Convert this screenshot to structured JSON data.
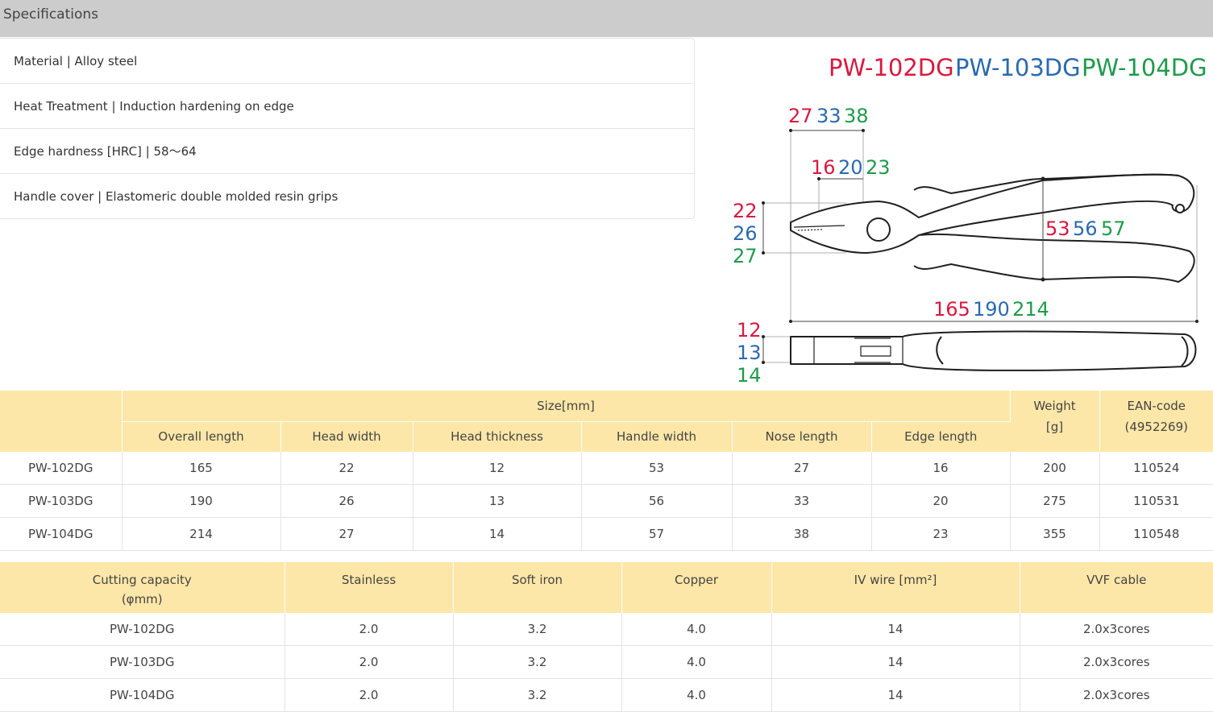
{
  "section_title": "Specifications",
  "specs": [
    "Material | Alloy steel",
    "Heat Treatment | Induction hardening on edge",
    "Edge hardness [HRC] | 58～64",
    "Handle cover | Elastomeric double molded resin grips"
  ],
  "colors": {
    "red": "#d8193f",
    "blue": "#2a6aae",
    "green": "#1f9a4b",
    "line": "#1f1f1f",
    "accent": "#fde7a8"
  },
  "diagram": {
    "models": [
      "PW-102DG",
      "PW-103DG",
      "PW-104DG"
    ],
    "nose_length": [
      "27",
      "33",
      "38"
    ],
    "edge_length": [
      "16",
      "20",
      "23"
    ],
    "head_width": [
      "22",
      "26",
      "27"
    ],
    "handle_width": [
      "53",
      "56",
      "57"
    ],
    "overall_length": [
      "165",
      "190",
      "214"
    ],
    "head_thickness": [
      "12",
      "13",
      "14"
    ]
  },
  "size_table": {
    "group_header": "Size[mm]",
    "weight_header_1": "Weight",
    "weight_header_2": "[g]",
    "ean_header_1": "EAN-code",
    "ean_header_2": "(4952269)",
    "columns": [
      "Overall length",
      "Head width",
      "Head thickness",
      "Handle width",
      "Nose length",
      "Edge length"
    ],
    "rows": [
      [
        "PW-102DG",
        "165",
        "22",
        "12",
        "53",
        "27",
        "16",
        "200",
        "110524"
      ],
      [
        "PW-103DG",
        "190",
        "26",
        "13",
        "56",
        "33",
        "20",
        "275",
        "110531"
      ],
      [
        "PW-104DG",
        "214",
        "27",
        "14",
        "57",
        "38",
        "23",
        "355",
        "110548"
      ]
    ]
  },
  "cutting_table": {
    "header_1": "Cutting capacity",
    "header_2": "(φmm)",
    "columns": [
      "Stainless",
      "Soft iron",
      "Copper",
      "IV wire [mm²]",
      "VVF cable"
    ],
    "rows": [
      [
        "PW-102DG",
        "2.0",
        "3.2",
        "4.0",
        "14",
        "2.0x3cores"
      ],
      [
        "PW-103DG",
        "2.0",
        "3.2",
        "4.0",
        "14",
        "2.0x3cores"
      ],
      [
        "PW-104DG",
        "2.0",
        "3.2",
        "4.0",
        "14",
        "2.0x3cores"
      ]
    ]
  }
}
